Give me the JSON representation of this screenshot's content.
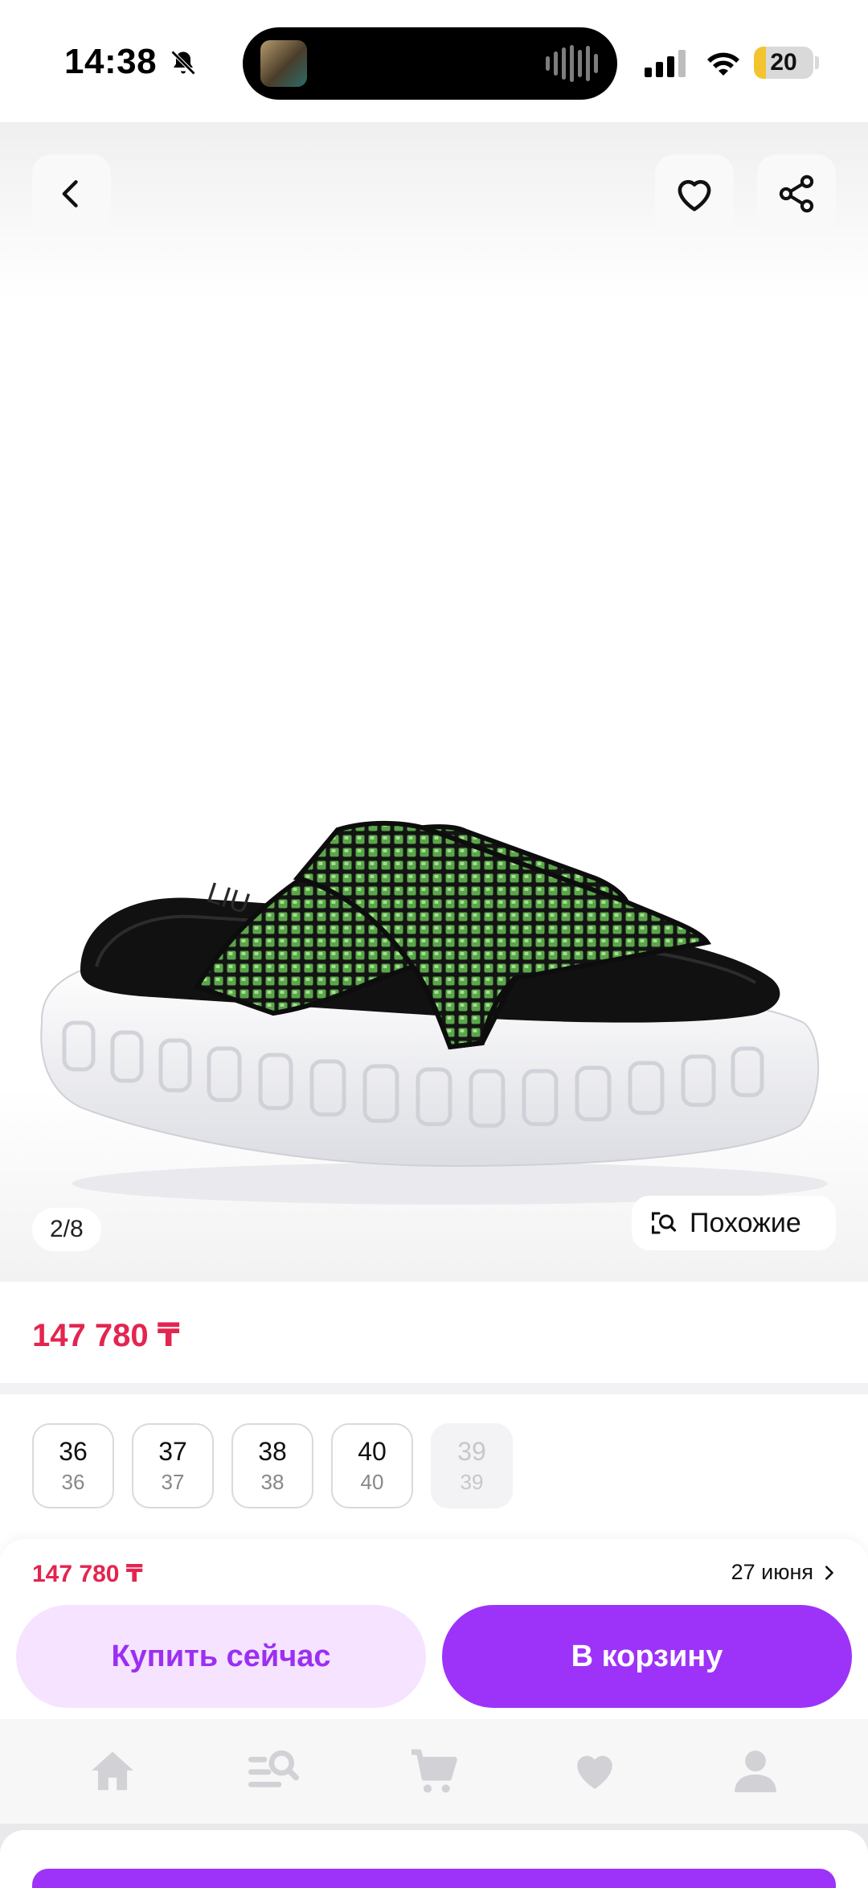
{
  "status_bar": {
    "time": "14:38",
    "battery_level": "20",
    "battery_fraction": 0.2,
    "icons": [
      "bell-slash-icon",
      "signal-icon",
      "wifi-icon",
      "battery-icon"
    ]
  },
  "gallery": {
    "counter": "2/8",
    "similar_label": "Похожие",
    "icons": [
      "chevron-left-icon",
      "heart-icon",
      "share-icon",
      "visual-search-icon"
    ]
  },
  "price": {
    "main": "147 780 ₸"
  },
  "sizes": [
    {
      "size": "36",
      "ru": "36",
      "available": true
    },
    {
      "size": "37",
      "ru": "37",
      "available": true
    },
    {
      "size": "38",
      "ru": "38",
      "available": true
    },
    {
      "size": "40",
      "ru": "40",
      "available": true
    },
    {
      "size": "39",
      "ru": "39",
      "available": false
    }
  ],
  "buy_panel": {
    "price": "147 780 ₸",
    "delivery_date": "27 июня",
    "buy_now_label": "Купить сейчас",
    "add_to_cart_label": "В корзину"
  },
  "tab_bar": {
    "tabs": [
      "home-icon",
      "catalog-search-icon",
      "cart-icon",
      "favorites-icon",
      "profile-icon"
    ]
  },
  "colors": {
    "accent": "#9d33f9",
    "accent_light": "#f5e3ff",
    "price": "#e3254f"
  }
}
